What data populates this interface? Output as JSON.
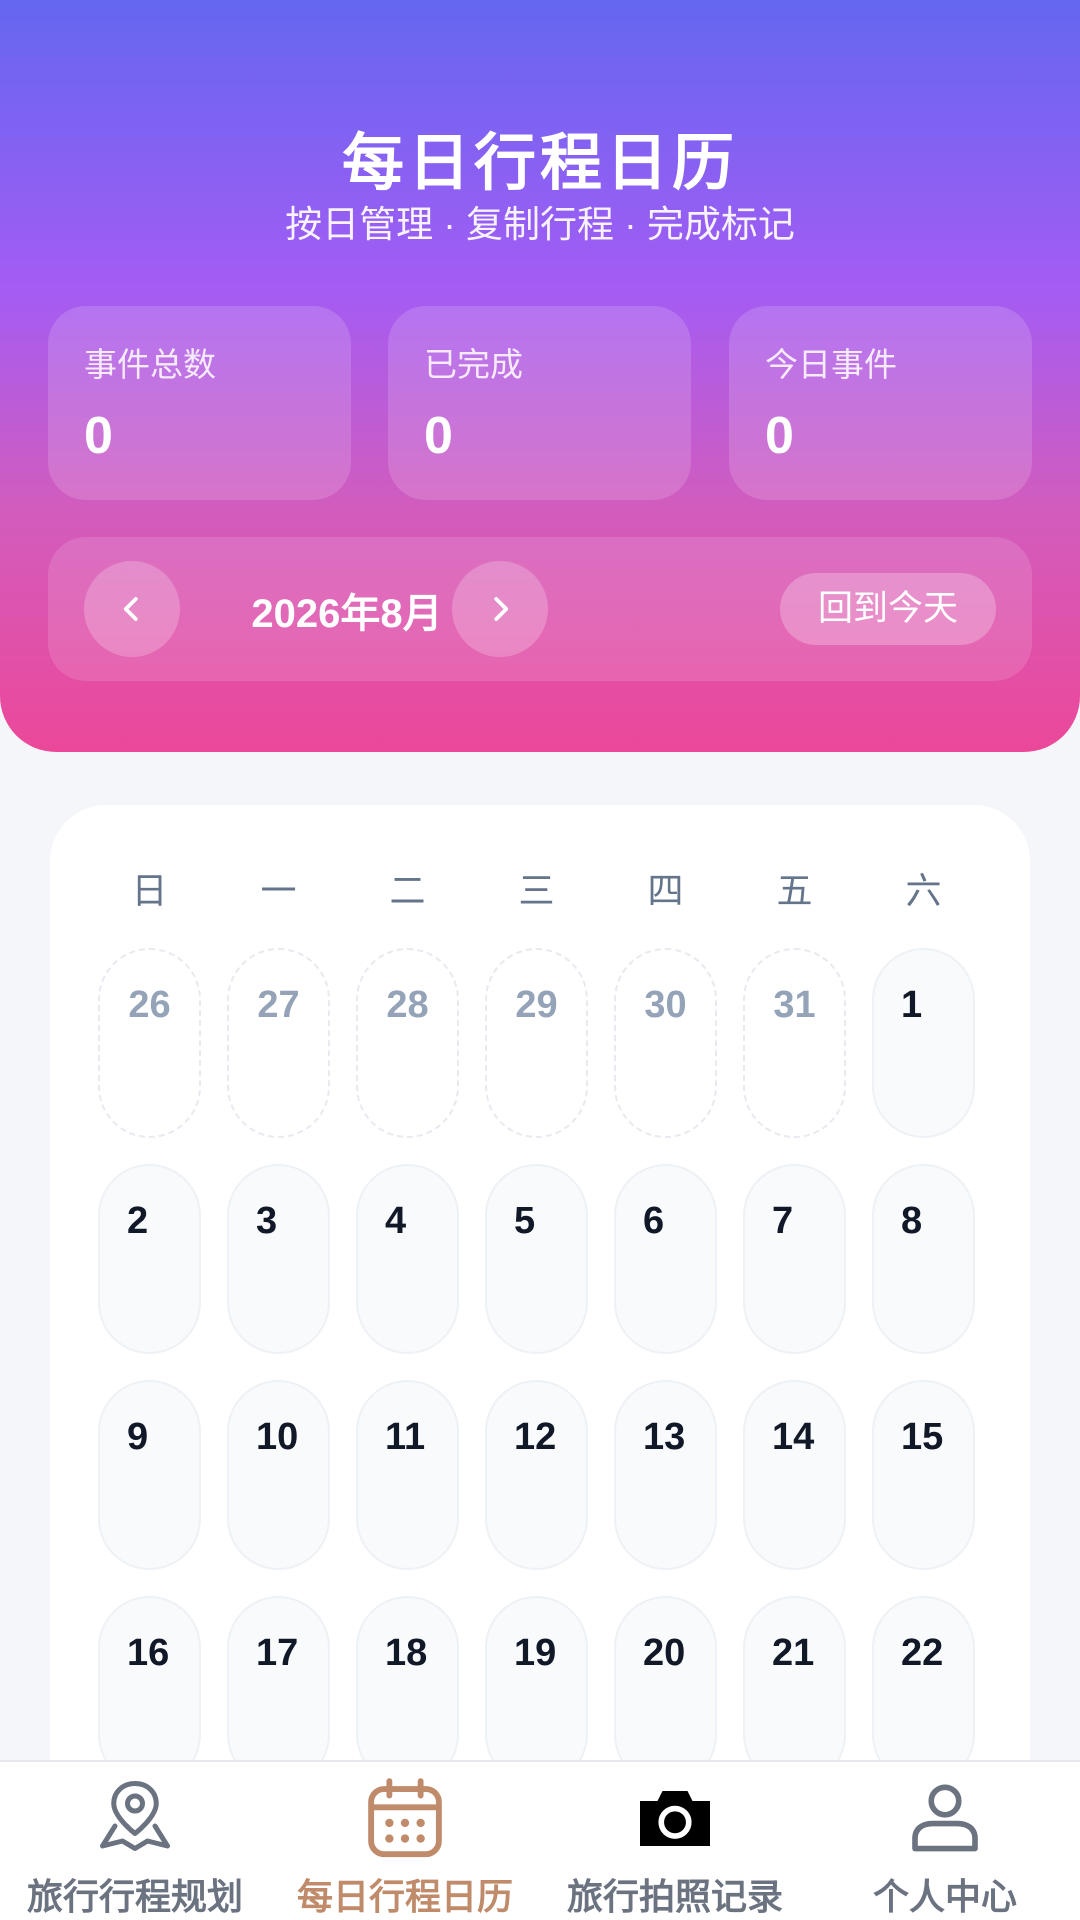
{
  "header": {
    "title": "每日行程日历",
    "subtitle": "按日管理 · 复制行程 · 完成标记"
  },
  "stats": [
    {
      "label": "事件总数",
      "value": "0"
    },
    {
      "label": "已完成",
      "value": "0"
    },
    {
      "label": "今日事件",
      "value": "0"
    }
  ],
  "month_nav": {
    "prev_icon": "chevron-left-icon",
    "label": "2026年8月",
    "next_icon": "chevron-right-icon",
    "today_button": "回到今天"
  },
  "calendar": {
    "weekdays": [
      "日",
      "一",
      "二",
      "三",
      "四",
      "五",
      "六"
    ],
    "weeks": [
      [
        {
          "day": "26",
          "other": true
        },
        {
          "day": "27",
          "other": true
        },
        {
          "day": "28",
          "other": true
        },
        {
          "day": "29",
          "other": true
        },
        {
          "day": "30",
          "other": true
        },
        {
          "day": "31",
          "other": true
        },
        {
          "day": "1",
          "other": false
        }
      ],
      [
        {
          "day": "2",
          "other": false
        },
        {
          "day": "3",
          "other": false
        },
        {
          "day": "4",
          "other": false
        },
        {
          "day": "5",
          "other": false
        },
        {
          "day": "6",
          "other": false
        },
        {
          "day": "7",
          "other": false
        },
        {
          "day": "8",
          "other": false
        }
      ],
      [
        {
          "day": "9",
          "other": false
        },
        {
          "day": "10",
          "other": false
        },
        {
          "day": "11",
          "other": false
        },
        {
          "day": "12",
          "other": false
        },
        {
          "day": "13",
          "other": false
        },
        {
          "day": "14",
          "other": false
        },
        {
          "day": "15",
          "other": false
        }
      ],
      [
        {
          "day": "16",
          "other": false
        },
        {
          "day": "17",
          "other": false
        },
        {
          "day": "18",
          "other": false
        },
        {
          "day": "19",
          "other": false
        },
        {
          "day": "20",
          "other": false
        },
        {
          "day": "21",
          "other": false
        },
        {
          "day": "22",
          "other": false
        }
      ]
    ]
  },
  "tabbar": {
    "tabs": [
      {
        "label": "旅行行程规划",
        "icon": "map-pin-icon",
        "active": false
      },
      {
        "label": "每日行程日历",
        "icon": "calendar-icon",
        "active": true
      },
      {
        "label": "旅行拍照记录",
        "icon": "camera-icon",
        "active": false
      },
      {
        "label": "个人中心",
        "icon": "user-icon",
        "active": false
      }
    ]
  },
  "colors": {
    "header_gradient": [
      "#6467f0",
      "#a35cf4",
      "#ec4899"
    ],
    "active_tab": "#c08b6a",
    "inactive_tab": "#6b7280"
  }
}
